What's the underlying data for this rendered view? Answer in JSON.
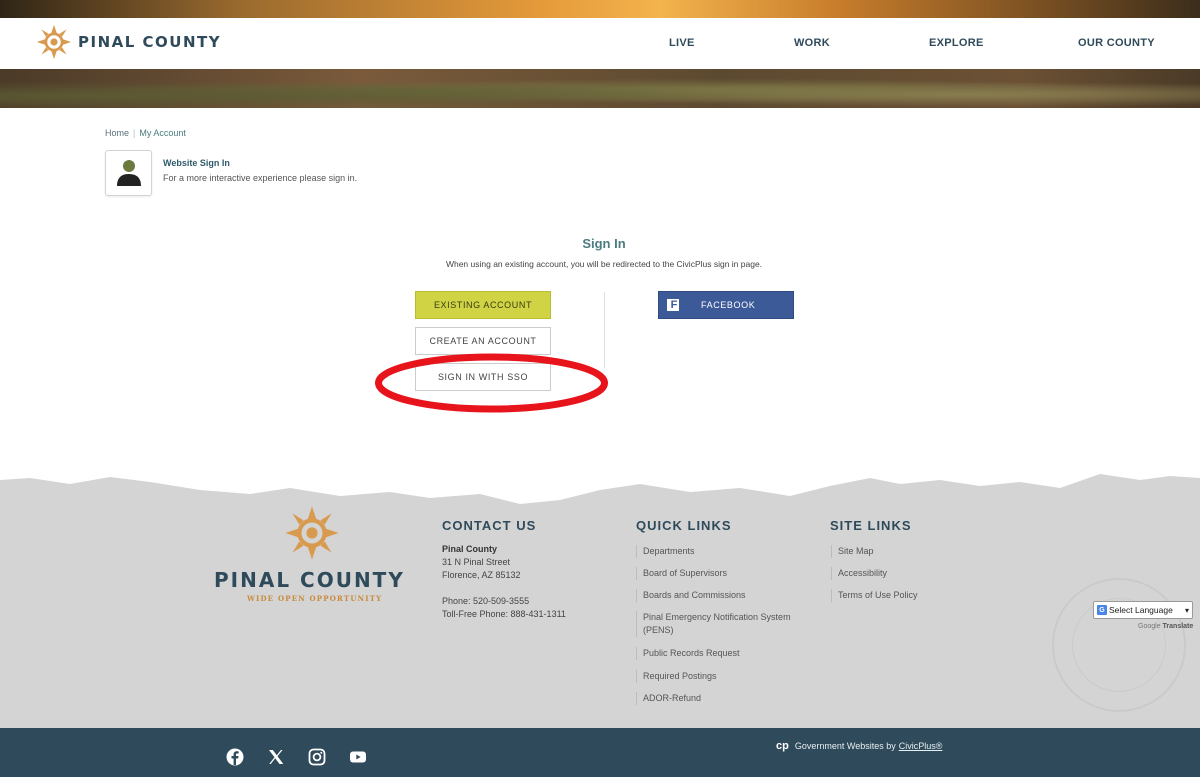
{
  "header": {
    "brand": "PINAL COUNTY",
    "nav": [
      "LIVE",
      "WORK",
      "EXPLORE",
      "OUR COUNTY"
    ]
  },
  "breadcrumb": {
    "home": "Home",
    "separator": "|",
    "current": "My Account"
  },
  "account": {
    "title": "Website Sign In",
    "description": "For a more interactive experience please sign in."
  },
  "signin": {
    "title": "Sign In",
    "note": "When using an existing account, you will be redirected to the CivicPlus sign in page.",
    "existing": "EXISTING ACCOUNT",
    "create": "CREATE AN ACCOUNT",
    "sso": "SIGN IN WITH SSO",
    "facebook": "FACEBOOK"
  },
  "footer": {
    "brand": "PINAL COUNTY",
    "tagline": "WIDE OPEN OPPORTUNITY",
    "contact": {
      "title": "CONTACT US",
      "org": "Pinal County",
      "street": "31 N Pinal Street",
      "city": "Florence, AZ 85132",
      "phone": "Phone: 520-509-3555",
      "tollfree": "Toll-Free Phone: 888-431-1311"
    },
    "quick_links": {
      "title": "QUICK LINKS",
      "items": [
        "Departments",
        "Board of Supervisors",
        "Boards and Commissions",
        "Pinal Emergency Notification System (PENS)",
        "Public Records Request",
        "Required Postings",
        "ADOR-Refund"
      ]
    },
    "site_links": {
      "title": "SITE LINKS",
      "items": [
        "Site Map",
        "Accessibility",
        "Terms of Use Policy"
      ]
    },
    "translate": {
      "select": "Select Language",
      "powered_by": "Google",
      "translate": "Translate"
    }
  },
  "bottom": {
    "credit": "Government Websites by",
    "credit_link": "CivicPlus®",
    "cp_logo": "cp"
  },
  "colors": {
    "brand_dark": "#2f4a5a",
    "accent_teal": "#4a7c80",
    "existing_btn": "#cfd344",
    "facebook": "#3d5a98",
    "highlight_red": "#e8141c",
    "footer_gray": "#d4d4d4"
  }
}
